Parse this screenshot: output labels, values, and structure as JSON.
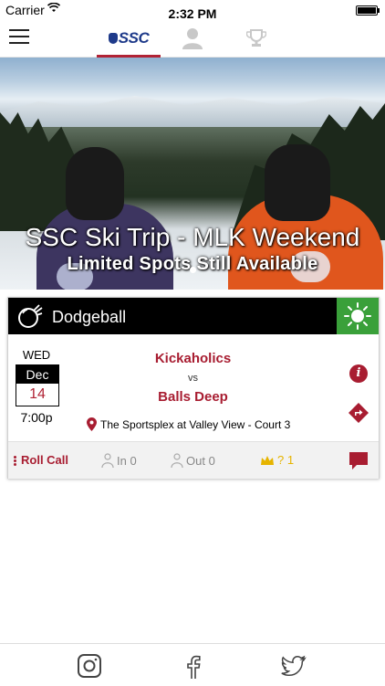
{
  "status_bar": {
    "carrier": "Carrier",
    "time": "2:32 PM"
  },
  "nav": {
    "tabs": [
      {
        "id": "ssc",
        "label": "SSC",
        "selected": true
      },
      {
        "id": "profile",
        "label": "",
        "selected": false
      },
      {
        "id": "trophy",
        "label": "",
        "selected": false
      }
    ]
  },
  "hero": {
    "title": "SSC Ski Trip - MLK Weekend",
    "subtitle": "Limited Spots Still Available",
    "slide_count": 1,
    "active_slide": 1
  },
  "game": {
    "sport": "Dodgeball",
    "weather_icon": "sun-icon",
    "day_of_week": "WED",
    "month": "Dec",
    "day": "14",
    "time": "7:00p",
    "home_team": "Kickaholics",
    "vs": "vs",
    "away_team": "Balls Deep",
    "location": "The Sportsplex at Valley View - Court 3",
    "roll_call_label": "Roll Call",
    "in_label": "In 0",
    "out_label": "Out 0",
    "maybe_label": "? 1"
  },
  "colors": {
    "accent": "#a81d31",
    "weather_bg": "#3aa03a",
    "brand_blue": "#1e3a8a",
    "maybe": "#e6b400"
  },
  "social": [
    "instagram-icon",
    "facebook-icon",
    "twitter-icon"
  ]
}
